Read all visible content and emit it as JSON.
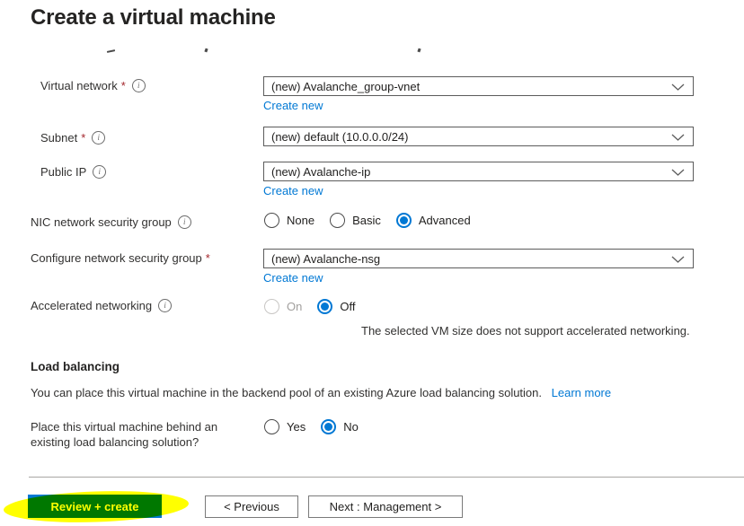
{
  "page": {
    "title": "Create a virtual machine"
  },
  "colors": {
    "accent_blue": "#0078d4",
    "primary_button_blue": "#0078d4",
    "highlight_annotation_yellow": "#ffff00",
    "required_red": "#a4262c"
  },
  "form": {
    "virtual_network": {
      "label": "Virtual network",
      "required_mark": "*",
      "value": "(new) Avalanche_group-vnet",
      "create_new_label": "Create new"
    },
    "subnet": {
      "label": "Subnet",
      "required_mark": "*",
      "value": "(new) default (10.0.0.0/24)"
    },
    "public_ip": {
      "label": "Public IP",
      "value": "(new) Avalanche-ip",
      "create_new_label": "Create new"
    },
    "nic_nsg": {
      "label": "NIC network security group",
      "options": [
        "None",
        "Basic",
        "Advanced"
      ],
      "selected": "Advanced"
    },
    "configure_nsg": {
      "label": "Configure network security group",
      "required_mark": "*",
      "value": "(new) Avalanche-nsg",
      "create_new_label": "Create new"
    },
    "accelerated_networking": {
      "label": "Accelerated networking",
      "options": [
        "On",
        "Off"
      ],
      "selected": "Off",
      "disabled_option": "On",
      "note": "The selected VM size does not support accelerated networking."
    }
  },
  "load_balancing": {
    "heading": "Load balancing",
    "description": "You can place this virtual machine in the backend pool of an existing Azure load balancing solution.",
    "learn_more_label": "Learn more",
    "question_line1": "Place this virtual machine behind an",
    "question_line2": "existing load balancing solution?",
    "options": [
      "Yes",
      "No"
    ],
    "selected": "No"
  },
  "footer": {
    "review_create_label": "Review + create",
    "previous_label": "< Previous",
    "next_label": "Next : Management >"
  }
}
